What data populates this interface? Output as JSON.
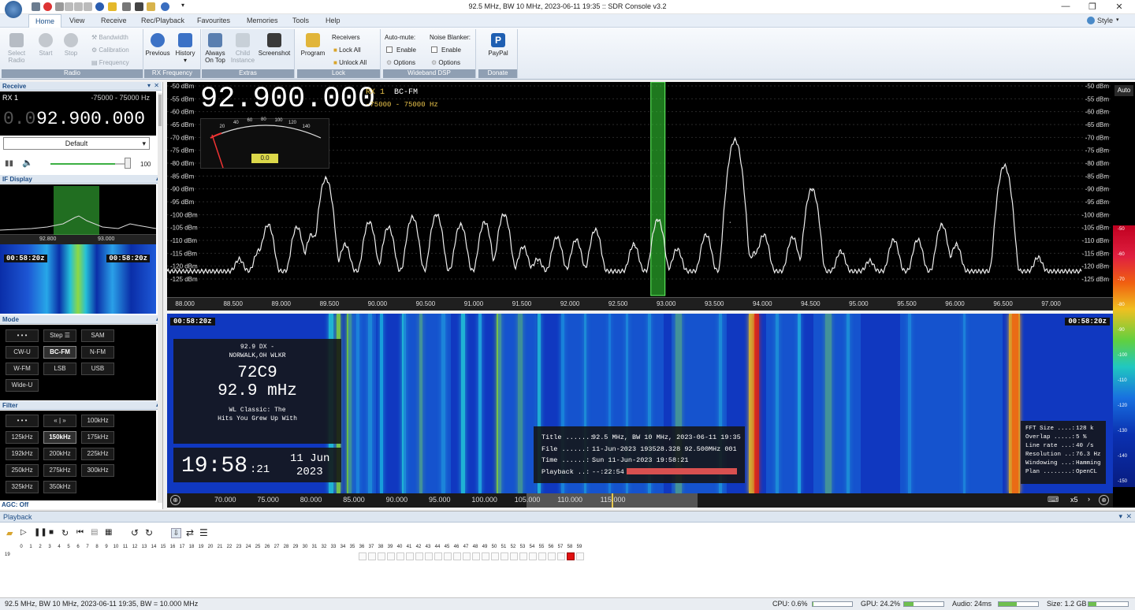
{
  "window": {
    "title": "92.5 MHz, BW 10 MHz, 2023-06-11 19:35 :: SDR Console v3.2",
    "style_menu": "Style"
  },
  "menu": [
    "Home",
    "View",
    "Receive",
    "Rec/Playback",
    "Favourites",
    "Memories",
    "Tools",
    "Help"
  ],
  "ribbon": {
    "radio": {
      "select": "Select Radio",
      "start": "Start",
      "stop": "Stop",
      "bandwidth": "Bandwidth",
      "calibration": "Calibration",
      "frequency": "Frequency",
      "group": "Radio"
    },
    "rxfreq": {
      "previous": "Previous",
      "history": "History",
      "group": "RX Frequency"
    },
    "extras": {
      "always_on_top": "Always On Top",
      "child_instance": "Child Instance",
      "screenshot": "Screenshot",
      "group": "Extras"
    },
    "lock": {
      "program": "Program",
      "receivers": "Receivers",
      "lock_all": "Lock All",
      "unlock_all": "Unlock All",
      "group": "Lock"
    },
    "dsp": {
      "automute": "Auto-mute:",
      "am_enable": "Enable",
      "am_options": "Options",
      "nb": "Noise Blanker:",
      "nb_enable": "Enable",
      "nb_options": "Options",
      "group": "Wideband DSP"
    },
    "donate": {
      "paypal": "PayPal",
      "group": "Donate"
    }
  },
  "receive": {
    "header": "Receive",
    "rx": "RX 1",
    "range": "-75000 - 75000 Hz",
    "freq_dim": "0.0",
    "freq": "92.900.000",
    "preset": "Default",
    "volume": "100",
    "volume_level": 0.85
  },
  "if_display": {
    "header": "IF Display",
    "tick_left": "92.800",
    "tick_right": "93.000",
    "time": "00:58:20z"
  },
  "mode": {
    "header": "Mode",
    "buttons": [
      "• • •",
      "Step ☰",
      "SAM",
      "CW-U",
      "BC-FM",
      "N-FM",
      "W-FM",
      "LSB",
      "USB",
      "Wide-U"
    ],
    "selected": "BC-FM"
  },
  "filter": {
    "header": "Filter",
    "buttons": [
      "• • •",
      "« | »",
      "100kHz",
      "125kHz",
      "150kHz",
      "175kHz",
      "192kHz",
      "200kHz",
      "225kHz",
      "250kHz",
      "275kHz",
      "300kHz",
      "325kHz",
      "350kHz"
    ],
    "selected": "150kHz",
    "agc": "AGC: Off"
  },
  "spectrum": {
    "freq": "92.900.000",
    "rx": "RX 1",
    "mode": "BC-FM",
    "range": "-75000 - 75000 Hz",
    "meter_value": "0.0",
    "meter_scale": [
      "20",
      "40",
      "60",
      "80",
      "100",
      "120",
      "140"
    ],
    "dbm_labels": [
      "-50 dBm",
      "-55 dBm",
      "-60 dBm",
      "-65 dBm",
      "-70 dBm",
      "-75 dBm",
      "-80 dBm",
      "-85 dBm",
      "-90 dBm",
      "-95 dBm",
      "-100 dBm",
      "-105 dBm",
      "-110 dBm",
      "-115 dBm",
      "-120 dBm",
      "-125 dBm"
    ],
    "freq_ticks": [
      "88.000",
      "88.500",
      "89.000",
      "89.500",
      "90.000",
      "90.500",
      "91.000",
      "91.500",
      "92.000",
      "92.500",
      "93.000",
      "93.500",
      "94.000",
      "94.500",
      "95.000",
      "95.500",
      "96.000",
      "96.500",
      "97.000"
    ],
    "auto": "Auto"
  },
  "chart_data": {
    "type": "line",
    "xlabel": "",
    "ylabel": "",
    "x_unit": "MHz",
    "y_unit": "dBm",
    "xlim": [
      87.8,
      97.3
    ],
    "ylim": [
      -125,
      -50
    ],
    "peaks": [
      {
        "x": 88.55,
        "y": -119
      },
      {
        "x": 88.75,
        "y": -115
      },
      {
        "x": 88.85,
        "y": -104
      },
      {
        "x": 89.15,
        "y": -105
      },
      {
        "x": 89.3,
        "y": -108
      },
      {
        "x": 89.45,
        "y": -86
      },
      {
        "x": 89.65,
        "y": -112
      },
      {
        "x": 89.9,
        "y": -103
      },
      {
        "x": 90.1,
        "y": -105
      },
      {
        "x": 90.35,
        "y": -101
      },
      {
        "x": 90.6,
        "y": -100
      },
      {
        "x": 90.85,
        "y": -104
      },
      {
        "x": 91.1,
        "y": -103
      },
      {
        "x": 91.3,
        "y": -100
      },
      {
        "x": 91.5,
        "y": -113
      },
      {
        "x": 91.65,
        "y": -119
      },
      {
        "x": 91.85,
        "y": -109
      },
      {
        "x": 92.05,
        "y": -110
      },
      {
        "x": 92.25,
        "y": -106
      },
      {
        "x": 92.65,
        "y": -112
      },
      {
        "x": 92.9,
        "y": -102
      },
      {
        "x": 93.1,
        "y": -114
      },
      {
        "x": 93.4,
        "y": -108
      },
      {
        "x": 93.65,
        "y": -103
      },
      {
        "x": 93.7,
        "y": -71
      },
      {
        "x": 93.9,
        "y": -116
      },
      {
        "x": 94.0,
        "y": -108
      },
      {
        "x": 94.3,
        "y": -109
      },
      {
        "x": 94.5,
        "y": -90
      },
      {
        "x": 94.8,
        "y": -115
      },
      {
        "x": 95.1,
        "y": -120
      },
      {
        "x": 95.35,
        "y": -110
      },
      {
        "x": 95.6,
        "y": -110
      },
      {
        "x": 95.85,
        "y": -104
      },
      {
        "x": 96.0,
        "y": -112
      },
      {
        "x": 96.5,
        "y": -81
      },
      {
        "x": 96.85,
        "y": -118
      }
    ],
    "baseline": -122
  },
  "waterfall": {
    "time_left": "00:58:20z",
    "time_right": "00:58:20z",
    "rds": {
      "line1": "92.9   DX   -",
      "line2": "NORWALK,OH   WLKR",
      "pi": "72C9",
      "freq": "92.9 mHz",
      "rt1": "WL   Classic: The",
      "rt2": "Hits You Grew Up With"
    },
    "clock": {
      "time": "19:58",
      "sec": ":21",
      "date": "11 Jun",
      "year": "2023"
    },
    "file_info": [
      {
        "k": "Title ......:",
        "v": "92.5 MHz, BW 10 MHz, 2023-06-11 19:35"
      },
      {
        "k": "File ......:",
        "v": "11-Jun-2023 193528.328 92.500MHz 001"
      },
      {
        "k": "Time ......:",
        "v": "Sun 11-Jun-2023 19:58:21"
      },
      {
        "k": "Playback ..:",
        "v": "--:22:54"
      }
    ],
    "playback_progress": 1.0,
    "fft_info": [
      {
        "k": "FFT Size ....:",
        "v": "128 k"
      },
      {
        "k": "Overlap .....:",
        "v": "5 %"
      },
      {
        "k": "Line rate ...:",
        "v": "40 /s"
      },
      {
        "k": "Resolution ..:",
        "v": "76.3 Hz"
      },
      {
        "k": "Windowing ...:",
        "v": "Hamming"
      },
      {
        "k": "Plan ........:",
        "v": "OpenCL"
      }
    ],
    "axis_ticks": [
      "70.000",
      "75.000",
      "80.000",
      "85.000",
      "90.000",
      "95.000",
      "100.000",
      "105.000",
      "110.000",
      "115.000"
    ],
    "zoom": "x5"
  },
  "right_scale": [
    "-50",
    "-60",
    "-70",
    "-80",
    "-90",
    "-100",
    "-110",
    "-120",
    "-130",
    "-140",
    "-150"
  ],
  "playback": {
    "header": "Playback",
    "minutes": [
      "0",
      "1",
      "2",
      "3",
      "4",
      "5",
      "6",
      "7",
      "8",
      "9",
      "10",
      "11",
      "12",
      "13",
      "14",
      "15",
      "16",
      "17",
      "18",
      "19",
      "20",
      "21",
      "22",
      "23",
      "24",
      "25",
      "26",
      "27",
      "28",
      "29",
      "30",
      "31",
      "32",
      "33",
      "34",
      "35",
      "36",
      "37",
      "38",
      "39",
      "40",
      "41",
      "42",
      "43",
      "44",
      "45",
      "46",
      "47",
      "48",
      "49",
      "50",
      "51",
      "52",
      "53",
      "54",
      "55",
      "56",
      "57",
      "58",
      "59"
    ],
    "hour": "19"
  },
  "status": {
    "left": "92.5 MHz, BW 10 MHz, 2023-06-11 19:35, BW = 10.000 MHz",
    "cpu": "CPU: 0.6%",
    "cpu_level": 0.02,
    "gpu": "GPU: 24.2%",
    "gpu_level": 0.24,
    "audio": "Audio: 24ms",
    "audio_level": 0.45,
    "size": "Size: 1.2 GB",
    "size_level": 0.2
  }
}
